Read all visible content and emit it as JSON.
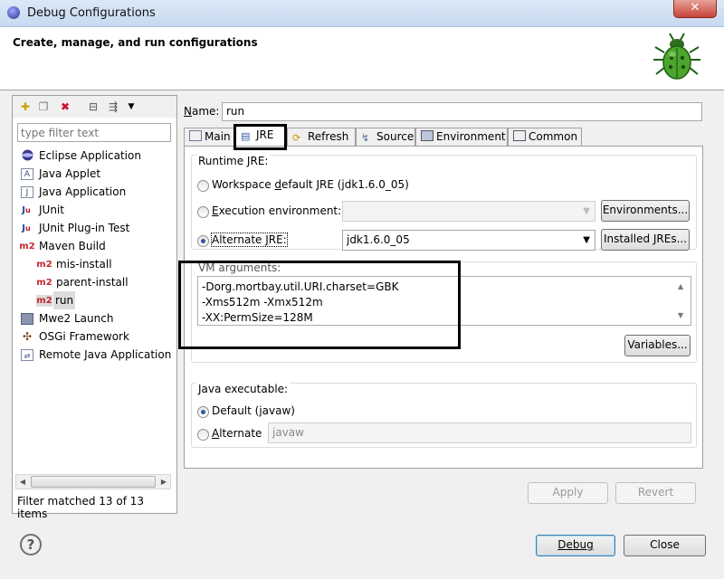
{
  "window": {
    "title": "Debug Configurations"
  },
  "banner": {
    "title": "Create, manage, and run configurations"
  },
  "sidebar": {
    "filter_placeholder": "type filter text",
    "items": [
      {
        "label": "Eclipse Application",
        "icon": "eclipse-app-icon"
      },
      {
        "label": "Java Applet",
        "icon": "java-applet-icon"
      },
      {
        "label": "Java Application",
        "icon": "java-app-icon"
      },
      {
        "label": "JUnit",
        "icon": "junit-icon"
      },
      {
        "label": "JUnit Plug-in Test",
        "icon": "junit-plugin-icon"
      },
      {
        "label": "Maven Build",
        "icon": "maven-icon"
      },
      {
        "label": "mis-install",
        "icon": "maven-icon"
      },
      {
        "label": "parent-install",
        "icon": "maven-icon"
      },
      {
        "label": "run",
        "icon": "maven-icon"
      },
      {
        "label": "Mwe2 Launch",
        "icon": "mwe2-icon"
      },
      {
        "label": "OSGi Framework",
        "icon": "osgi-icon"
      },
      {
        "label": "Remote Java Application",
        "icon": "remote-java-icon"
      }
    ],
    "maven_badge": "m2",
    "filter_status": "Filter matched 13 of 13 items"
  },
  "config": {
    "name_label_prefix": "N",
    "name_label_rest": "ame:",
    "name_value": "run",
    "tabs": [
      {
        "label": "Main"
      },
      {
        "label": "JRE"
      },
      {
        "label": "Refresh"
      },
      {
        "label": "Source"
      },
      {
        "label": "Environment"
      },
      {
        "label": "Common"
      }
    ]
  },
  "jre": {
    "runtime_title": "Runtime JRE:",
    "workspace_label_a": "Workspace ",
    "workspace_label_u": "d",
    "workspace_label_b": "efault JRE (jdk1.6.0_05)",
    "exec_env_u": "E",
    "exec_env_rest": "xecution environment:",
    "environments_button": "Environments...",
    "alternate_jre_a": "Alternate ",
    "alternate_jre_u": "J",
    "alternate_jre_b": "RE:",
    "alternate_jre_value": "jdk1.6.0_05",
    "installed_jres_button": "Installed JREs...",
    "vm_title": "VM arguments:",
    "vm_args": [
      "-Dorg.mortbay.util.URI.charset=GBK",
      "-Xms512m -Xmx512m",
      "-XX:PermSize=128M"
    ],
    "variables_button": "Variables...",
    "java_exec_title": "Java executable:",
    "default_exec": "Default (javaw)",
    "alternate_u": "A",
    "alternate_rest": "lternate",
    "alternate_value": "javaw"
  },
  "footer": {
    "apply": "Apply",
    "revert": "Revert",
    "debug": "Debug",
    "close": "Close"
  }
}
